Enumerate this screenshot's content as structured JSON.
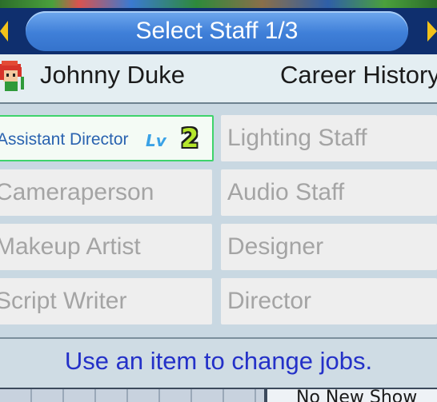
{
  "title": "Select Staff 1/3",
  "staff": {
    "name": "Johnny Duke",
    "career_label": "Career History"
  },
  "jobs": [
    {
      "label": "Assistant Director",
      "selected": true,
      "level_prefix": "Lv",
      "level": "2"
    },
    {
      "label": "Lighting Staff"
    },
    {
      "label": "Cameraperson"
    },
    {
      "label": "Audio Staff"
    },
    {
      "label": "Makeup Artist"
    },
    {
      "label": "Designer"
    },
    {
      "label": "Script Writer"
    },
    {
      "label": "Director"
    }
  ],
  "hint": "Use an item to change jobs.",
  "background": {
    "text": "No New Show"
  },
  "colors": {
    "title_bar": "#0f2f6e",
    "title_pill": "#3f7fd8",
    "arrow": "#f2c21a",
    "selected_border": "#3ed36b",
    "hint_text": "#2431c8"
  }
}
